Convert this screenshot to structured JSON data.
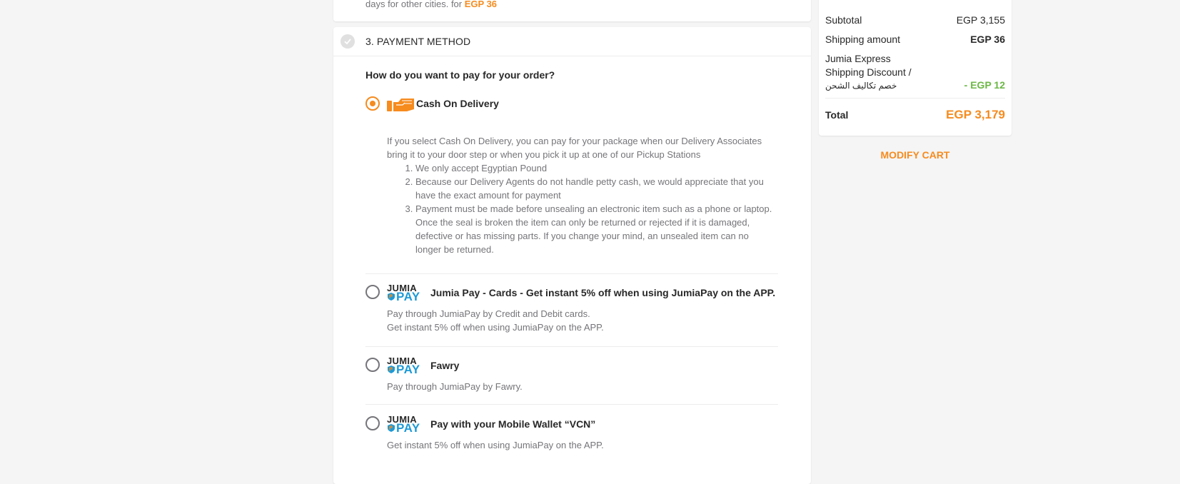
{
  "shipping_note": {
    "text": "days for other cities. for ",
    "price": "EGP 36"
  },
  "payment": {
    "section_title": "3. PAYMENT METHOD",
    "question": "How do you want to pay for your order?",
    "options": [
      {
        "label": "Cash On Delivery",
        "selected": true,
        "icon": "cash-hand-icon",
        "intro": "If you select Cash On Delivery, you can pay for your package when our Delivery Associates bring it to your door step or when you pick it up at one of our Pickup Stations",
        "rules": [
          "We only accept Egyptian Pound",
          "Because our Delivery Agents do not handle petty cash, we would appreciate that you have the exact amount for payment",
          "Payment must be made before unsealing an electronic item such as a phone or laptop. Once the seal is broken the item can only be returned or rejected if it is damaged, defective or has missing parts. If you change your mind, an unsealed item can no longer be returned."
        ]
      },
      {
        "label": "Jumia Pay - Cards - Get instant 5% off when using JumiaPay on the APP.",
        "selected": false,
        "logo_top": "JUMIA",
        "logo_bottom": "PAY",
        "desc_line1": "Pay through JumiaPay by Credit and Debit cards.",
        "desc_line2": "Get instant 5% off when using JumiaPay on the APP."
      },
      {
        "label": "Fawry",
        "selected": false,
        "logo_top": "JUMIA",
        "logo_bottom": "PAY",
        "desc_line1": "Pay through JumiaPay by Fawry."
      },
      {
        "label": "Pay with your Mobile Wallet “VCN”",
        "selected": false,
        "logo_top": "JUMIA",
        "logo_bottom": "PAY",
        "desc_line1": "Get instant 5% off when using JumiaPay on the APP."
      }
    ]
  },
  "summary": {
    "subtotal_label": "Subtotal",
    "subtotal_value": "EGP 3,155",
    "shipping_label": "Shipping amount",
    "shipping_value": "EGP 36",
    "discount_line1": "Jumia Express",
    "discount_line2": "Shipping Discount /",
    "discount_line3": "خصم تكاليف الشحن",
    "discount_value": "- EGP 12",
    "total_label": "Total",
    "total_value": "EGP 3,179",
    "modify_cart": "MODIFY CART"
  },
  "colors": {
    "accent": "#f68b1e",
    "discount_green": "#6bb744",
    "jumiapay_blue": "#1d9ad6"
  }
}
